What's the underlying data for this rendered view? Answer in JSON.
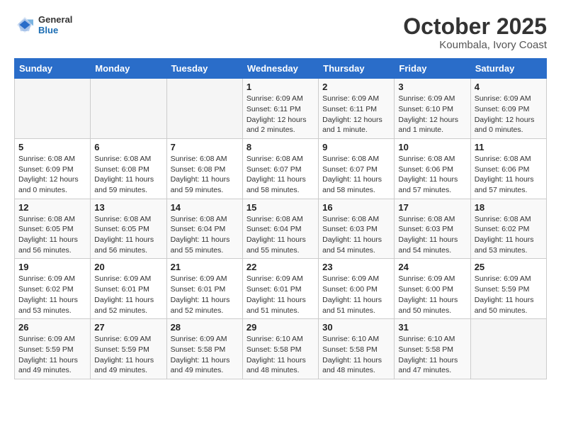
{
  "header": {
    "logo_general": "General",
    "logo_blue": "Blue",
    "month": "October 2025",
    "location": "Koumbala, Ivory Coast"
  },
  "weekdays": [
    "Sunday",
    "Monday",
    "Tuesday",
    "Wednesday",
    "Thursday",
    "Friday",
    "Saturday"
  ],
  "weeks": [
    [
      {
        "day": "",
        "info": ""
      },
      {
        "day": "",
        "info": ""
      },
      {
        "day": "",
        "info": ""
      },
      {
        "day": "1",
        "info": "Sunrise: 6:09 AM\nSunset: 6:11 PM\nDaylight: 12 hours\nand 2 minutes."
      },
      {
        "day": "2",
        "info": "Sunrise: 6:09 AM\nSunset: 6:11 PM\nDaylight: 12 hours\nand 1 minute."
      },
      {
        "day": "3",
        "info": "Sunrise: 6:09 AM\nSunset: 6:10 PM\nDaylight: 12 hours\nand 1 minute."
      },
      {
        "day": "4",
        "info": "Sunrise: 6:09 AM\nSunset: 6:09 PM\nDaylight: 12 hours\nand 0 minutes."
      }
    ],
    [
      {
        "day": "5",
        "info": "Sunrise: 6:08 AM\nSunset: 6:09 PM\nDaylight: 12 hours\nand 0 minutes."
      },
      {
        "day": "6",
        "info": "Sunrise: 6:08 AM\nSunset: 6:08 PM\nDaylight: 11 hours\nand 59 minutes."
      },
      {
        "day": "7",
        "info": "Sunrise: 6:08 AM\nSunset: 6:08 PM\nDaylight: 11 hours\nand 59 minutes."
      },
      {
        "day": "8",
        "info": "Sunrise: 6:08 AM\nSunset: 6:07 PM\nDaylight: 11 hours\nand 58 minutes."
      },
      {
        "day": "9",
        "info": "Sunrise: 6:08 AM\nSunset: 6:07 PM\nDaylight: 11 hours\nand 58 minutes."
      },
      {
        "day": "10",
        "info": "Sunrise: 6:08 AM\nSunset: 6:06 PM\nDaylight: 11 hours\nand 57 minutes."
      },
      {
        "day": "11",
        "info": "Sunrise: 6:08 AM\nSunset: 6:06 PM\nDaylight: 11 hours\nand 57 minutes."
      }
    ],
    [
      {
        "day": "12",
        "info": "Sunrise: 6:08 AM\nSunset: 6:05 PM\nDaylight: 11 hours\nand 56 minutes."
      },
      {
        "day": "13",
        "info": "Sunrise: 6:08 AM\nSunset: 6:05 PM\nDaylight: 11 hours\nand 56 minutes."
      },
      {
        "day": "14",
        "info": "Sunrise: 6:08 AM\nSunset: 6:04 PM\nDaylight: 11 hours\nand 55 minutes."
      },
      {
        "day": "15",
        "info": "Sunrise: 6:08 AM\nSunset: 6:04 PM\nDaylight: 11 hours\nand 55 minutes."
      },
      {
        "day": "16",
        "info": "Sunrise: 6:08 AM\nSunset: 6:03 PM\nDaylight: 11 hours\nand 54 minutes."
      },
      {
        "day": "17",
        "info": "Sunrise: 6:08 AM\nSunset: 6:03 PM\nDaylight: 11 hours\nand 54 minutes."
      },
      {
        "day": "18",
        "info": "Sunrise: 6:08 AM\nSunset: 6:02 PM\nDaylight: 11 hours\nand 53 minutes."
      }
    ],
    [
      {
        "day": "19",
        "info": "Sunrise: 6:09 AM\nSunset: 6:02 PM\nDaylight: 11 hours\nand 53 minutes."
      },
      {
        "day": "20",
        "info": "Sunrise: 6:09 AM\nSunset: 6:01 PM\nDaylight: 11 hours\nand 52 minutes."
      },
      {
        "day": "21",
        "info": "Sunrise: 6:09 AM\nSunset: 6:01 PM\nDaylight: 11 hours\nand 52 minutes."
      },
      {
        "day": "22",
        "info": "Sunrise: 6:09 AM\nSunset: 6:01 PM\nDaylight: 11 hours\nand 51 minutes."
      },
      {
        "day": "23",
        "info": "Sunrise: 6:09 AM\nSunset: 6:00 PM\nDaylight: 11 hours\nand 51 minutes."
      },
      {
        "day": "24",
        "info": "Sunrise: 6:09 AM\nSunset: 6:00 PM\nDaylight: 11 hours\nand 50 minutes."
      },
      {
        "day": "25",
        "info": "Sunrise: 6:09 AM\nSunset: 5:59 PM\nDaylight: 11 hours\nand 50 minutes."
      }
    ],
    [
      {
        "day": "26",
        "info": "Sunrise: 6:09 AM\nSunset: 5:59 PM\nDaylight: 11 hours\nand 49 minutes."
      },
      {
        "day": "27",
        "info": "Sunrise: 6:09 AM\nSunset: 5:59 PM\nDaylight: 11 hours\nand 49 minutes."
      },
      {
        "day": "28",
        "info": "Sunrise: 6:09 AM\nSunset: 5:58 PM\nDaylight: 11 hours\nand 49 minutes."
      },
      {
        "day": "29",
        "info": "Sunrise: 6:10 AM\nSunset: 5:58 PM\nDaylight: 11 hours\nand 48 minutes."
      },
      {
        "day": "30",
        "info": "Sunrise: 6:10 AM\nSunset: 5:58 PM\nDaylight: 11 hours\nand 48 minutes."
      },
      {
        "day": "31",
        "info": "Sunrise: 6:10 AM\nSunset: 5:58 PM\nDaylight: 11 hours\nand 47 minutes."
      },
      {
        "day": "",
        "info": ""
      }
    ]
  ]
}
